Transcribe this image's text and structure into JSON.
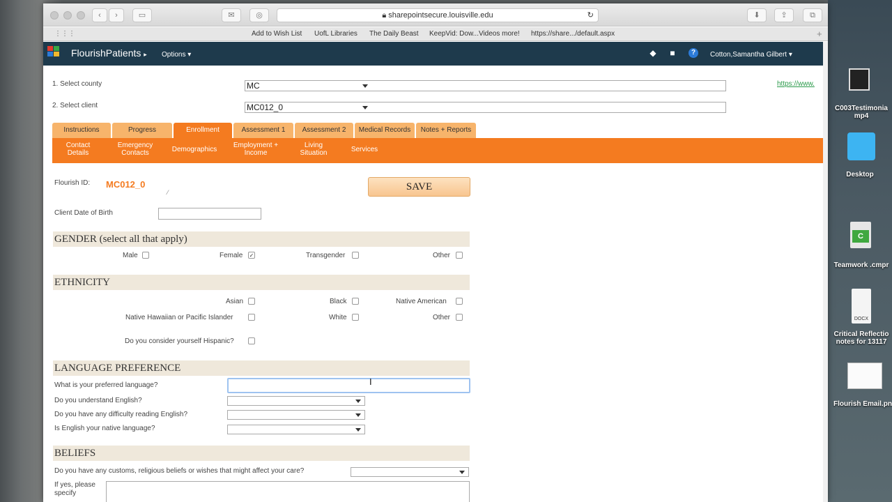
{
  "browser": {
    "url": "sharepointsecure.louisville.edu",
    "bookmarks": [
      "Add to Wish List",
      "UofL Libraries",
      "The Daily Beast",
      "KeepVid: Dow...Videos more!",
      "https://share.../default.aspx"
    ]
  },
  "app": {
    "name": "FlourishPatients",
    "options_label": "Options",
    "user": "Cotton,Samantha Gilbert",
    "help_icon": "?"
  },
  "form": {
    "county_label": "1. Select county",
    "county_value": "MC",
    "client_label": "2. Select client",
    "client_value": "MC012_0",
    "right_link": "https://www.",
    "tabs": [
      "Instructions",
      "Progress",
      "Enrollment",
      "Assessment 1",
      "Assessment 2",
      "Medical Records",
      "Notes + Reports"
    ],
    "subtabs": {
      "contact": [
        "Contact",
        "Details"
      ],
      "emergency": [
        "Emergency",
        "Contacts"
      ],
      "demographics": "Demographics",
      "employment": [
        "Employment +",
        "Income"
      ],
      "living": [
        "Living",
        "Situation"
      ],
      "services": "Services"
    },
    "flourish_id_label": "Flourish ID:",
    "flourish_id_value": "MC012_0",
    "save_label": "SAVE",
    "dob_label": "Client Date of Birth",
    "gender": {
      "title": "GENDER (select all that apply)",
      "male": "Male",
      "female": "Female",
      "transgender": "Transgender",
      "other": "Other",
      "female_checked": "✓"
    },
    "ethnicity": {
      "title": "ETHNICITY",
      "asian": "Asian",
      "black": "Black",
      "native_american": "Native American",
      "hawaiian": "Native Hawaiian or Pacific Islander",
      "white": "White",
      "other": "Other",
      "hispanic": "Do you consider yourself Hispanic?"
    },
    "language": {
      "title": "LANGUAGE PREFERENCE",
      "preferred": "What is your preferred language?",
      "understand": "Do you understand English?",
      "difficulty": "Do you have any difficulty reading English?",
      "native": "Is English your native language?"
    },
    "beliefs": {
      "title": "BELIEFS",
      "customs": "Do you have any customs, religious beliefs or wishes that might affect your care?",
      "specify": [
        "If yes, please",
        "specify"
      ]
    }
  },
  "desktop": {
    "file1": [
      "C003Testimonia",
      "mp4"
    ],
    "desktop_label": "Desktop",
    "file2": "Teamwork .cmpr",
    "docx_label": "DOCX",
    "file3": [
      "Critical Reflectio",
      "notes for 13117"
    ],
    "file4": "Flourish Email.pn"
  }
}
